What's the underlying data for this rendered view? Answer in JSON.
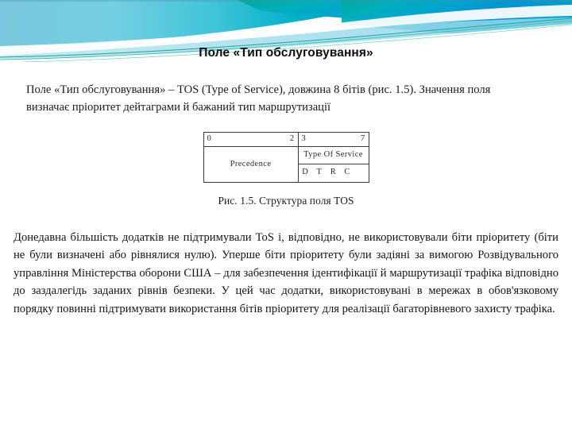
{
  "slide": {
    "title": "Поле «Тип обслуговування»",
    "intro_paragraph": "Поле «Тип обслуговування» – TOS (Type of Service), довжина 8 бітів  (рис. 1.5). Значення поля визначає пріоритет дейтаграми й бажаний тип маршрутизації",
    "body_paragraph": "Донедавна більшість додатків не підтримували ToS і, відповідно, не використовували біти пріоритету (біти не були визначені або рівнялися нулю). Уперше біти пріоритету були задіяні за вимогою Розвідувального управління Міністерства оборони США – для забезпечення ідентифікації й маршрутизації трафіка відповідно до заздалегідь заданих рівнів безпеки. У цей час додатки, використовувані в мережах в обов'язковому порядку повинні підтримувати використання бітів пріоритету для реалізації багаторівневого захисту трафіка."
  },
  "figure": {
    "caption": "Рис. 1.5. Структура поля TOS",
    "precedence_index_start": "0",
    "precedence_index_end": "2",
    "tos_index_start": "3",
    "tos_index_end": "7",
    "precedence_label": "Precedence",
    "tos_label": "Type Of Service",
    "bits": [
      "D",
      "T",
      "R",
      "C",
      ""
    ]
  },
  "theme": {
    "banner_teal_dark": "#009999",
    "banner_cyan": "#00A6D6",
    "banner_blue": "#0091C8",
    "banner_light_blue": "#7FD4E8",
    "banner_pale": "#A8DDEB",
    "title_color": "#0D0D0D",
    "text_color": "#1A1A1A",
    "rule_color": "#3A3A3A"
  }
}
